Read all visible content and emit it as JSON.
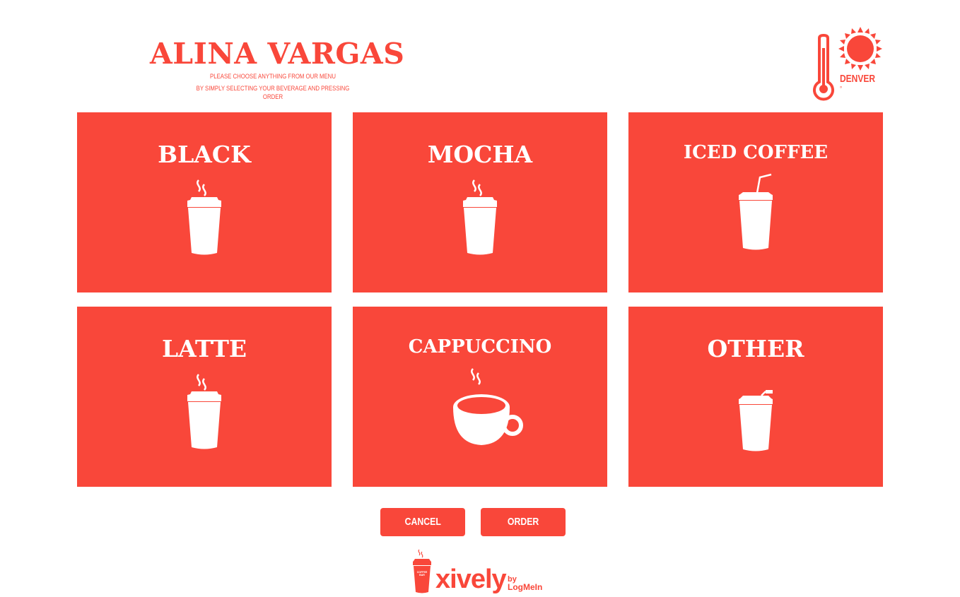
{
  "header": {
    "title": "ALINA VARGAS",
    "subtitle_line1": "PLEASE CHOOSE ANYTHING FROM OUR MENU",
    "subtitle_line2": "BY SIMPLY SELECTING YOUR BEVERAGE AND PRESSING ORDER"
  },
  "weather": {
    "city": "DENVER",
    "temperature": "°",
    "icons": [
      "thermometer-icon",
      "sun-icon"
    ]
  },
  "menu": {
    "items": [
      {
        "label": "BLACK",
        "icon": "hot-cup-icon"
      },
      {
        "label": "MOCHA",
        "icon": "hot-cup-icon"
      },
      {
        "label": "ICED COFFEE",
        "icon": "iced-cup-icon"
      },
      {
        "label": "LATTE",
        "icon": "hot-cup-icon"
      },
      {
        "label": "CAPPUCCINO",
        "icon": "coffee-mug-icon"
      },
      {
        "label": "OTHER",
        "icon": "capped-cup-icon"
      }
    ]
  },
  "actions": {
    "cancel_label": "CANCEL",
    "order_label": "ORDER"
  },
  "footer": {
    "brand": "xively",
    "by": "by",
    "partner": "LogMeIn",
    "cup_text": "COFFEE BAR"
  },
  "colors": {
    "accent": "#f9473a",
    "tile_text": "#ffffff",
    "background": "#ffffff"
  }
}
